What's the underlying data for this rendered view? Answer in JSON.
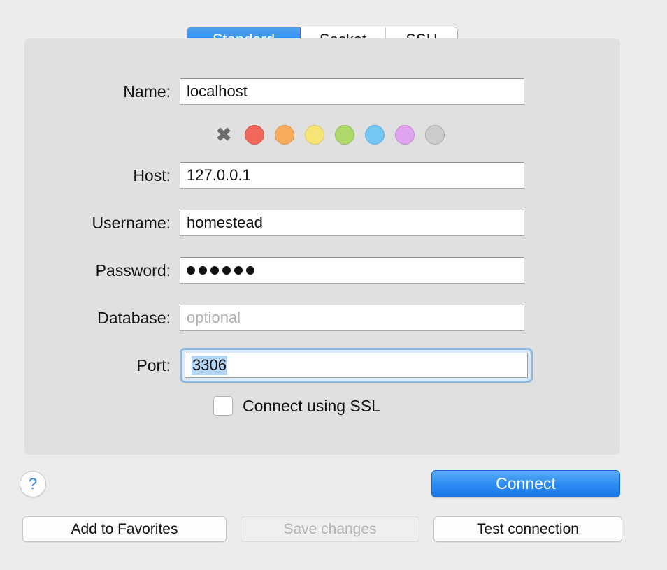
{
  "tabs": [
    {
      "label": "Standard",
      "active": true
    },
    {
      "label": "Socket",
      "active": false
    },
    {
      "label": "SSH",
      "active": false
    }
  ],
  "form": {
    "name": {
      "label": "Name:",
      "value": "localhost",
      "placeholder": ""
    },
    "host": {
      "label": "Host:",
      "value": "127.0.0.1",
      "placeholder": ""
    },
    "username": {
      "label": "Username:",
      "value": "homestead",
      "placeholder": ""
    },
    "password": {
      "label": "Password:",
      "value": "●●●●●●",
      "dots": 6,
      "placeholder": ""
    },
    "database": {
      "label": "Database:",
      "value": "",
      "placeholder": "optional"
    },
    "port": {
      "label": "Port:",
      "value": "3306",
      "placeholder": "",
      "focused": true,
      "selected": true
    }
  },
  "colors": {
    "none_label": "✖",
    "swatches": [
      {
        "name": "red",
        "hex": "#f2675c",
        "border": "#d4564c"
      },
      {
        "name": "orange",
        "hex": "#f9ac5c",
        "border": "#dd944c"
      },
      {
        "name": "yellow",
        "hex": "#f6e477",
        "border": "#d9c765"
      },
      {
        "name": "green",
        "hex": "#aed86a",
        "border": "#95bd57"
      },
      {
        "name": "blue",
        "hex": "#74c6f5",
        "border": "#5eaade"
      },
      {
        "name": "purple",
        "hex": "#dfa3ef",
        "border": "#c18bd1"
      },
      {
        "name": "gray",
        "hex": "#cccccc",
        "border": "#ababab"
      }
    ]
  },
  "ssl": {
    "label": "Connect using SSL",
    "checked": false
  },
  "bottom": {
    "help_label": "?",
    "connect_label": "Connect",
    "add_favorites_label": "Add to Favorites",
    "save_changes_label": "Save changes",
    "save_changes_disabled": true,
    "test_connection_label": "Test connection"
  },
  "theme": {
    "window_bg": "#ececec",
    "panel_bg": "#e0e0e0",
    "accent": "#1a7df0",
    "focus_ring": "#8fb8e0",
    "selection": "#b5d5f5"
  }
}
